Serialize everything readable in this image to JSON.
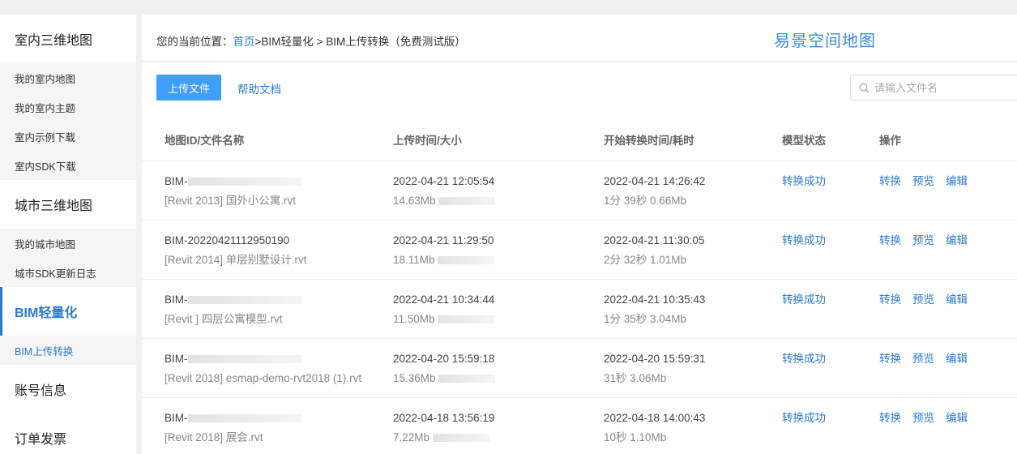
{
  "sidebar": {
    "sections": [
      {
        "title": "室内三维地图",
        "items": [
          "我的室内地图",
          "我的室内主题",
          "室内示例下载",
          "室内SDK下载"
        ]
      },
      {
        "title": "城市三维地图",
        "items": [
          "我的城市地图",
          "城市SDK更新日志"
        ]
      },
      {
        "title": "BIM轻量化",
        "items": [
          "BIM上传转换"
        ]
      },
      {
        "title": "账号信息",
        "items": []
      },
      {
        "title": "订单发票",
        "items": []
      }
    ]
  },
  "breadcrumb": {
    "prefix": "您的当前位置：",
    "home": "首页",
    "sep1": ">",
    "bim": "BIM轻量化",
    "sep2": " > ",
    "current": "BIM上传转换（免费测试版）"
  },
  "brand": "易景空间地图",
  "toolbar": {
    "upload": "上传文件",
    "help": "帮助文档",
    "search_placeholder": "请输入文件名"
  },
  "table": {
    "headers": [
      "地图ID/文件名称",
      "上传时间/大小",
      "开始转换时间/耗时",
      "模型状态",
      "操作"
    ],
    "rows": [
      {
        "id": "BIM-",
        "masked_id": true,
        "file": "[Revit 2013] 国外小公寓.rvt",
        "upload_time": "2022-04-21 12:05:54",
        "size": "14.63Mb",
        "start_time": "2022-04-21 14:26:42",
        "duration": "1分 39秒 0.66Mb",
        "status": "转换成功",
        "ops": [
          "转换",
          "预览",
          "编辑"
        ]
      },
      {
        "id": "BIM-20220421112950190",
        "masked_id": false,
        "file": "[Revit 2014] 单层别墅设计.rvt",
        "upload_time": "2022-04-21 11:29:50",
        "size": "18.11Mb",
        "start_time": "2022-04-21 11:30:05",
        "duration": "2分 32秒 1.01Mb",
        "status": "转换成功",
        "ops": [
          "转换",
          "预览",
          "编辑"
        ]
      },
      {
        "id": "BIM-",
        "masked_id": true,
        "file": "[Revit ] 四层公寓模型.rvt",
        "upload_time": "2022-04-21 10:34:44",
        "size": "11.50Mb",
        "start_time": "2022-04-21 10:35:43",
        "duration": "1分 35秒 3.04Mb",
        "status": "转换成功",
        "ops": [
          "转换",
          "预览",
          "编辑"
        ]
      },
      {
        "id": "BIM-",
        "masked_id": true,
        "file": "[Revit 2018] esmap-demo-rvt2018 (1).rvt",
        "upload_time": "2022-04-20 15:59:18",
        "size": "15.36Mb",
        "start_time": "2022-04-20 15:59:31",
        "duration": "31秒 3.06Mb",
        "status": "转换成功",
        "ops": [
          "转换",
          "预览",
          "编辑"
        ]
      },
      {
        "id": "BIM-",
        "masked_id": true,
        "file": "[Revit 2018] 展会.rvt",
        "upload_time": "2022-04-18 13:56:19",
        "size": "7.22Mb",
        "start_time": "2022-04-18 14:00:43",
        "duration": "10秒 1.10Mb",
        "status": "转换成功",
        "ops": [
          "转换",
          "预览",
          "编辑"
        ]
      }
    ]
  }
}
